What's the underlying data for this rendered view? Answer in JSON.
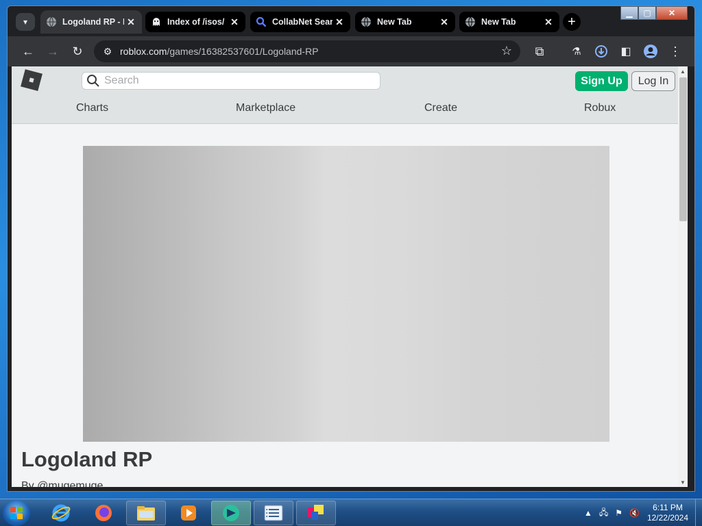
{
  "browser": {
    "tabs": [
      {
        "title": "Logoland RP - Roblox",
        "active": true,
        "favicon": "globe-icon"
      },
      {
        "title": "Index of /isos/",
        "active": false,
        "favicon": "ghost-icon"
      },
      {
        "title": "CollabNet Search",
        "active": false,
        "favicon": "search-icon"
      },
      {
        "title": "New Tab",
        "active": false,
        "favicon": "globe-icon"
      },
      {
        "title": "New Tab",
        "active": false,
        "favicon": "globe-icon"
      }
    ],
    "new_tab_label": "+",
    "url_host": "roblox.com",
    "url_path": "/games/16382537601/Logoland-RP"
  },
  "site": {
    "search_placeholder": "Search",
    "signup_label": "Sign Up",
    "login_label": "Log In",
    "nav": [
      "Charts",
      "Marketplace",
      "Create",
      "Robux"
    ]
  },
  "game": {
    "title": "Logoland RP",
    "creator": "By @mugemuge"
  },
  "taskbar": {
    "time": "6:11 PM",
    "date": "12/22/2024"
  },
  "colors": {
    "signup_bg": "#00b06f",
    "browser_bg": "#202124",
    "header_bg": "#dfe3e4"
  }
}
